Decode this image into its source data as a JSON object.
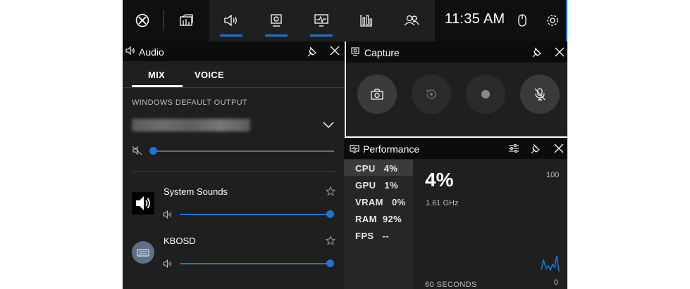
{
  "topbar": {
    "clock": "11:35 AM",
    "icons": [
      "xbox-icon",
      "widget-menu-icon",
      "audio-icon",
      "capture-icon",
      "performance-icon",
      "resources-icon",
      "social-icon",
      "mouse-icon",
      "settings-icon"
    ]
  },
  "audio": {
    "title": "Audio",
    "tabs": [
      "MIX",
      "VOICE"
    ],
    "active_tab": "MIX",
    "output_label": "WINDOWS DEFAULT OUTPUT",
    "device_volume_percent": 0,
    "apps": [
      {
        "name": "System Sounds",
        "volume_percent": 100
      },
      {
        "name": "KBOSD",
        "volume_percent": 100
      }
    ]
  },
  "capture": {
    "title": "Capture",
    "buttons": [
      "screenshot",
      "record-last",
      "record",
      "mic-mute"
    ]
  },
  "performance": {
    "title": "Performance",
    "metrics": [
      {
        "label": "CPU",
        "value": "4%"
      },
      {
        "label": "GPU",
        "value": "1%"
      },
      {
        "label": "VRAM",
        "value": "0%"
      },
      {
        "label": "RAM",
        "value": "92%"
      },
      {
        "label": "FPS",
        "value": "--"
      }
    ],
    "selected": "CPU",
    "big_value": "4%",
    "sub_value": "1.61 GHz",
    "scale_max": "100",
    "scale_min": "0",
    "time_label": "60 SECONDS"
  },
  "colors": {
    "accent": "#1b74d8",
    "panel": "#1f1f1f",
    "header": "#0c0c0c"
  }
}
